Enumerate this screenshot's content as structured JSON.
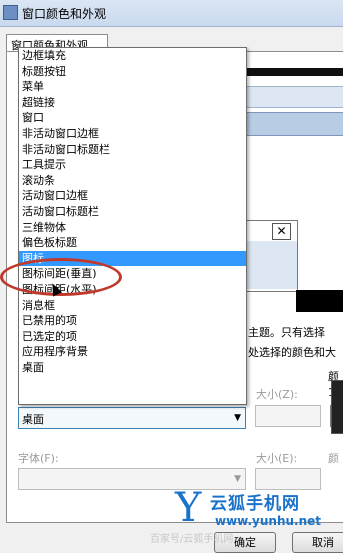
{
  "window": {
    "title": "窗口颜色和外观"
  },
  "tab": {
    "label": "窗口颜色和外观"
  },
  "item_list": {
    "options": [
      "边框填充",
      "标题按钮",
      "菜单",
      "超链接",
      "窗口",
      "非活动窗口边框",
      "非活动窗口标题栏",
      "工具提示",
      "滚动条",
      "活动窗口边框",
      "活动窗口标题栏",
      "三维物体",
      "偏色板标题",
      "图标",
      "图标间距(垂直)",
      "图标间距(水平)",
      "消息框",
      "已禁用的项",
      "已选定的项",
      "应用程序背景",
      "桌面"
    ],
    "selected": "图标"
  },
  "info_text": {
    "line1": "主题。只有选择",
    "line2": "处选择的颜色和大"
  },
  "item_combo": {
    "value": "桌面"
  },
  "size_label": "大小(Z):",
  "size2_label": "大小(E):",
  "color_label_partial": "颜",
  "color2_label_partial": "颜",
  "one_digit_partial": "1(",
  "font_label": "字体(F):",
  "buttons": {
    "ok": "确定",
    "cancel": "取消"
  },
  "watermark": {
    "logo_letter": "Y",
    "name": "云狐手机网",
    "url": "www.yunhu.net",
    "baidu": "百家号/云狐手机网"
  },
  "colors": {
    "selection": "#3399ff",
    "highlight_circle": "#c0392b",
    "watermark": "#1b73c9"
  }
}
